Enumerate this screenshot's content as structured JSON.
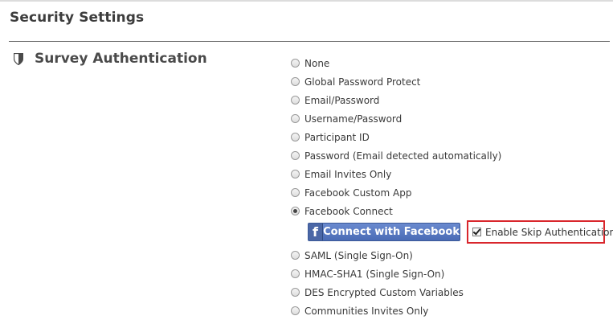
{
  "header": {
    "title": "Security Settings"
  },
  "section": {
    "icon": "shield-icon",
    "title": "Survey Authentication"
  },
  "auth_options": {
    "selected": "Facebook Connect",
    "items": [
      {
        "label": "None",
        "checked": false
      },
      {
        "label": "Global Password Protect",
        "checked": false
      },
      {
        "label": "Email/Password",
        "checked": false
      },
      {
        "label": "Username/Password",
        "checked": false
      },
      {
        "label": "Participant ID",
        "checked": false
      },
      {
        "label": "Password (Email detected automatically)",
        "checked": false
      },
      {
        "label": "Email Invites Only",
        "checked": false
      },
      {
        "label": "Facebook Custom App",
        "checked": false
      },
      {
        "label": "Facebook Connect",
        "checked": true
      },
      {
        "label": "SAML (Single Sign-On)",
        "checked": false
      },
      {
        "label": "HMAC-SHA1 (Single Sign-On)",
        "checked": false
      },
      {
        "label": "DES Encrypted Custom Variables",
        "checked": false
      },
      {
        "label": "Communities Invites Only",
        "checked": false
      }
    ]
  },
  "facebook": {
    "logo_glyph": "f",
    "button_label": "Connect with Facebook",
    "brand_color": "#3b5998"
  },
  "skip_auth": {
    "label": "Enable Skip Authentication",
    "checked": true,
    "highlight_color": "#d9262c"
  }
}
